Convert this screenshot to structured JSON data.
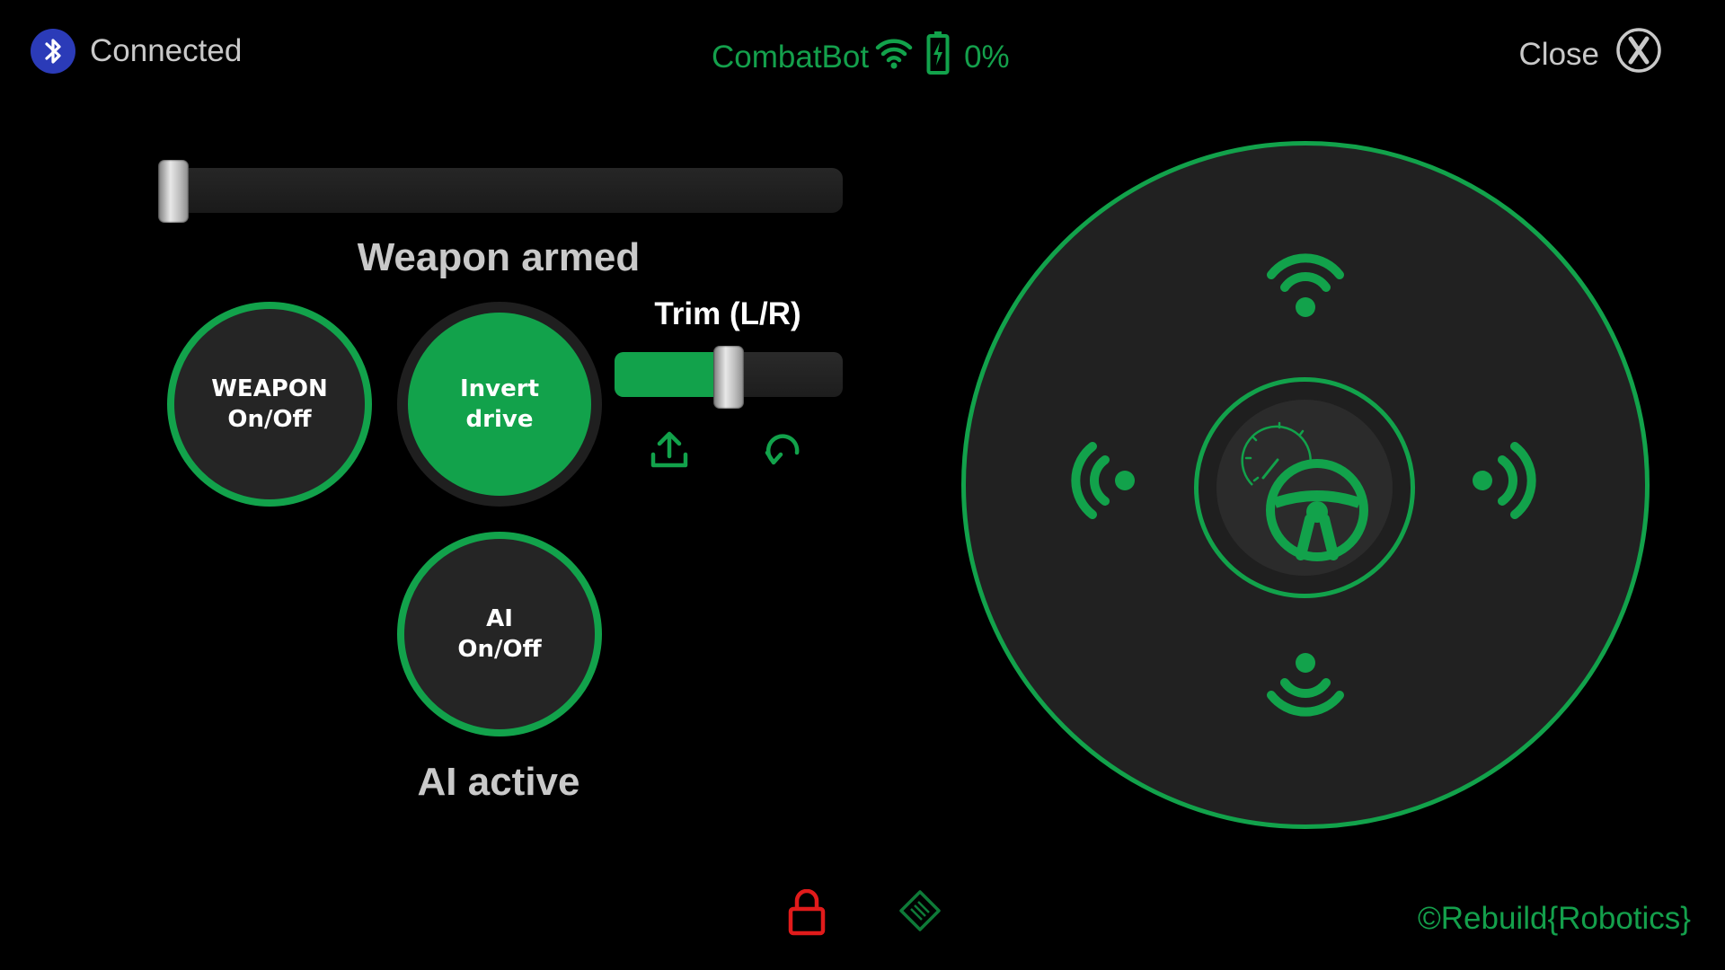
{
  "status_bar": {
    "bluetooth_icon": "bluetooth-icon",
    "connection_status": "Connected",
    "robot_name": "CombatBot",
    "signal_icon": "wifi-icon",
    "battery_icon": "battery-charging-icon",
    "battery_percent": "0%",
    "close_label": "Close",
    "close_icon": "close-circle-icon"
  },
  "controls": {
    "weapon_slider_level": 0,
    "weapon_status": "Weapon armed",
    "weapon_button": "WEAPON\nOn/Off",
    "invert_button": "Invert\ndrive",
    "ai_button": "AI\nOn/Off",
    "ai_status": "AI active",
    "trim": {
      "label": "Trim (L/R)",
      "level": 0.5,
      "save_icon": "upload-icon",
      "reset_icon": "reset-icon"
    }
  },
  "joystick": {
    "up_icon": "signal-up-icon",
    "down_icon": "signal-down-icon",
    "left_icon": "signal-left-icon",
    "right_icon": "signal-right-icon",
    "center_icon": "steering-wheel-icon",
    "gauge_icon": "speedometer-icon"
  },
  "footer": {
    "lock_icon": "lock-open-icon",
    "diamond_icon": "diamond-icon",
    "copyright": "©Rebuild{Robotics}"
  },
  "colors": {
    "accent": "#12a24b",
    "text_green": "#14a04c",
    "text_gray": "#c9c9c9",
    "bluetooth_blue": "#2b3bb8",
    "lock_red": "#e11b1b",
    "background": "#000000",
    "panel": "#212121"
  }
}
